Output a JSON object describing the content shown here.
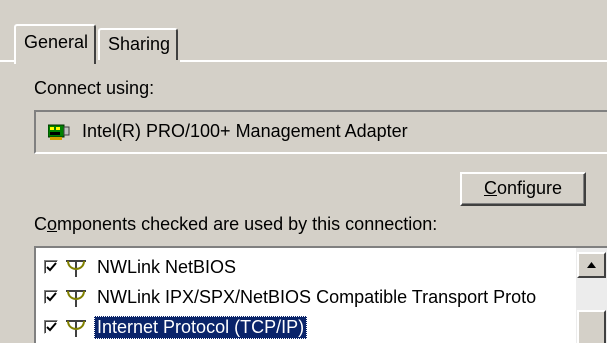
{
  "tabs": [
    {
      "label": "General",
      "active": true
    },
    {
      "label": "Sharing",
      "active": false
    }
  ],
  "connect_using_label": "Connect using:",
  "adapter": {
    "name": "Intel(R) PRO/100+ Management Adapter",
    "icon": "network-adapter-icon"
  },
  "configure_button": {
    "mnemonic": "C",
    "rest": "onfigure"
  },
  "components_label": {
    "pre": "C",
    "mnemonic": "o",
    "rest": "mponents checked are used by this connection:"
  },
  "components": [
    {
      "label": "NWLink NetBIOS",
      "checked": true,
      "selected": false,
      "icon": "protocol-icon"
    },
    {
      "label": "NWLink IPX/SPX/NetBIOS Compatible Transport Proto",
      "checked": true,
      "selected": false,
      "icon": "protocol-icon"
    },
    {
      "label": "Internet Protocol (TCP/IP)",
      "checked": true,
      "selected": true,
      "icon": "protocol-icon"
    }
  ],
  "colors": {
    "face": "#d4d0c8",
    "selection": "#0a246a",
    "window": "#ffffff"
  }
}
